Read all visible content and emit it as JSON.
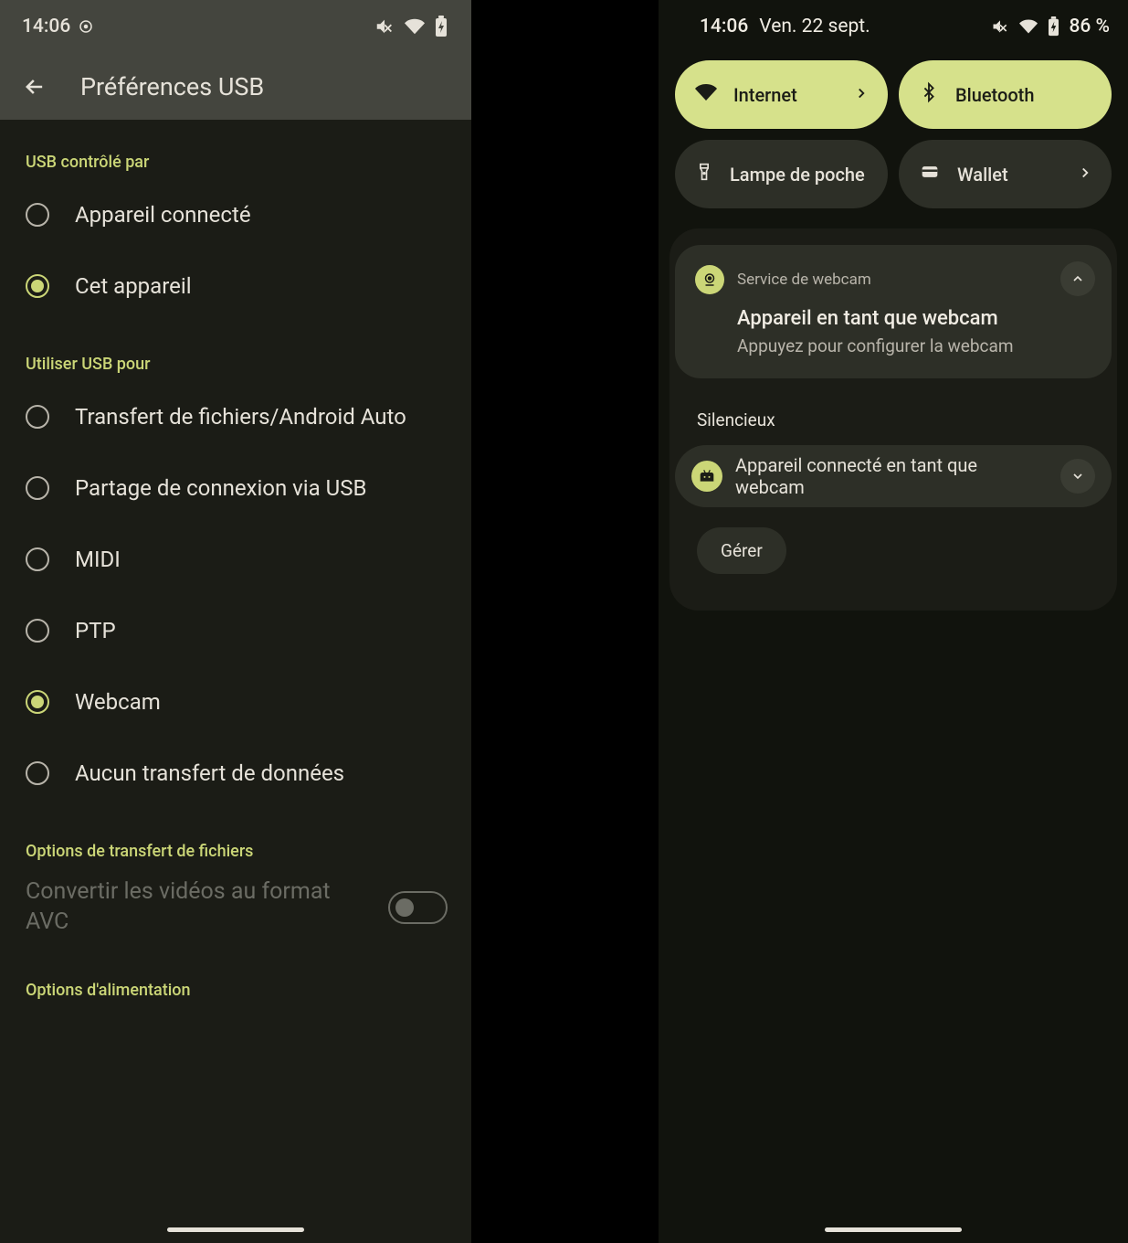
{
  "left": {
    "time": "14:06",
    "title": "Préférences USB",
    "section_control": "USB contrôlé par",
    "control_options": [
      {
        "label": "Appareil connecté",
        "checked": false
      },
      {
        "label": "Cet appareil",
        "checked": true
      }
    ],
    "section_use": "Utiliser USB pour",
    "use_options": [
      {
        "label": "Transfert de fichiers/Android Auto",
        "checked": false
      },
      {
        "label": "Partage de connexion via USB",
        "checked": false
      },
      {
        "label": "MIDI",
        "checked": false
      },
      {
        "label": "PTP",
        "checked": false
      },
      {
        "label": "Webcam",
        "checked": true
      },
      {
        "label": "Aucun transfert de données",
        "checked": false
      }
    ],
    "section_transfer": "Options de transfert de fichiers",
    "toggle_avc": "Convertir les vidéos au format AVC",
    "section_power": "Options d'alimentation"
  },
  "right": {
    "time": "14:06",
    "date": "Ven. 22 sept.",
    "battery": "86 %",
    "qs": {
      "internet": "Internet",
      "bluetooth": "Bluetooth",
      "flashlight": "Lampe de poche",
      "wallet": "Wallet"
    },
    "notif1": {
      "app": "Service de webcam",
      "title": "Appareil en tant que webcam",
      "sub": "Appuyez pour configurer la webcam"
    },
    "silent_label": "Silencieux",
    "notif2_text": "Appareil connecté en tant que webcam",
    "manage": "Gérer"
  }
}
